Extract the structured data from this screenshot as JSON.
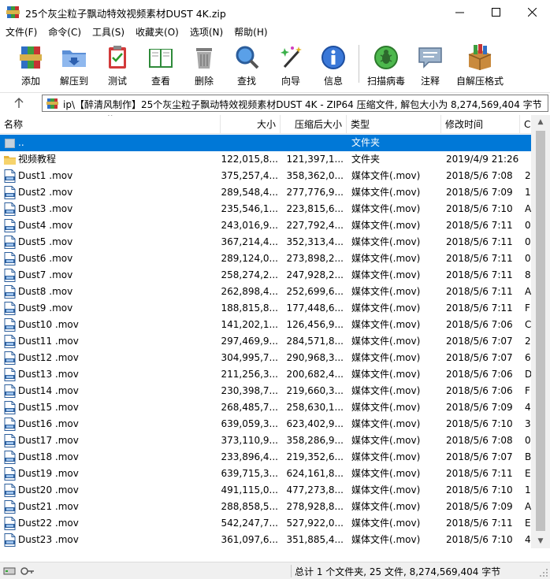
{
  "window": {
    "title": "25个灰尘粒子飘动特效视频素材DUST 4K.zip",
    "minimize_glyph": "—",
    "maximize_glyph": "☐",
    "close_glyph": "✕"
  },
  "menu": {
    "items": [
      "文件(F)",
      "命令(C)",
      "工具(S)",
      "收藏夹(O)",
      "选项(N)",
      "帮助(H)"
    ]
  },
  "toolbar": {
    "buttons": [
      {
        "label": "添加",
        "icon": "add-archive-icon"
      },
      {
        "label": "解压到",
        "icon": "extract-folder-icon"
      },
      {
        "label": "测试",
        "icon": "test-clipboard-icon"
      },
      {
        "label": "查看",
        "icon": "view-book-icon"
      },
      {
        "label": "删除",
        "icon": "trash-bin-icon"
      },
      {
        "label": "查找",
        "icon": "magnifier-icon"
      },
      {
        "label": "向导",
        "icon": "wizard-wand-icon"
      },
      {
        "label": "信息",
        "icon": "info-icon"
      },
      {
        "label": "扫描病毒",
        "icon": "virus-scan-icon"
      },
      {
        "label": "注释",
        "icon": "comment-icon"
      },
      {
        "label": "自解压格式",
        "icon": "sfx-box-icon"
      }
    ]
  },
  "address": {
    "path": "ip\\【醉清风制作】25个灰尘粒子飘动特效视频素材DUST 4K - ZIP64 压缩文件, 解包大小为 8,274,569,404 字节"
  },
  "columns": [
    "名称",
    "大小",
    "压缩后大小",
    "类型",
    "修改时间",
    "C"
  ],
  "rows": [
    {
      "name": "..",
      "size": "",
      "packed": "",
      "type": "文件夹",
      "date": "",
      "crc": "",
      "kind": "parent",
      "selected": true
    },
    {
      "name": "视频教程",
      "size": "122,015,8...",
      "packed": "121,397,1...",
      "type": "文件夹",
      "date": "2019/4/9 21:26",
      "crc": "",
      "kind": "folder"
    },
    {
      "name": "Dust1 .mov",
      "size": "375,257,4...",
      "packed": "358,362,0...",
      "type": "媒体文件(.mov)",
      "date": "2018/5/6 7:08",
      "crc": "2",
      "kind": "file"
    },
    {
      "name": "Dust2 .mov",
      "size": "289,548,4...",
      "packed": "277,776,9...",
      "type": "媒体文件(.mov)",
      "date": "2018/5/6 7:09",
      "crc": "1",
      "kind": "file"
    },
    {
      "name": "Dust3 .mov",
      "size": "235,546,1...",
      "packed": "223,815,6...",
      "type": "媒体文件(.mov)",
      "date": "2018/5/6 7:10",
      "crc": "A",
      "kind": "file"
    },
    {
      "name": "Dust4 .mov",
      "size": "243,016,9...",
      "packed": "227,792,4...",
      "type": "媒体文件(.mov)",
      "date": "2018/5/6 7:11",
      "crc": "0",
      "kind": "file"
    },
    {
      "name": "Dust5 .mov",
      "size": "367,214,4...",
      "packed": "352,313,4...",
      "type": "媒体文件(.mov)",
      "date": "2018/5/6 7:11",
      "crc": "0",
      "kind": "file"
    },
    {
      "name": "Dust6 .mov",
      "size": "289,124,0...",
      "packed": "273,898,2...",
      "type": "媒体文件(.mov)",
      "date": "2018/5/6 7:11",
      "crc": "0",
      "kind": "file"
    },
    {
      "name": "Dust7 .mov",
      "size": "258,274,2...",
      "packed": "247,928,2...",
      "type": "媒体文件(.mov)",
      "date": "2018/5/6 7:11",
      "crc": "8",
      "kind": "file"
    },
    {
      "name": "Dust8 .mov",
      "size": "262,898,4...",
      "packed": "252,699,6...",
      "type": "媒体文件(.mov)",
      "date": "2018/5/6 7:11",
      "crc": "A",
      "kind": "file"
    },
    {
      "name": "Dust9 .mov",
      "size": "188,815,8...",
      "packed": "177,448,6...",
      "type": "媒体文件(.mov)",
      "date": "2018/5/6 7:11",
      "crc": "F",
      "kind": "file"
    },
    {
      "name": "Dust10 .mov",
      "size": "141,202,1...",
      "packed": "126,456,9...",
      "type": "媒体文件(.mov)",
      "date": "2018/5/6 7:06",
      "crc": "C",
      "kind": "file"
    },
    {
      "name": "Dust11 .mov",
      "size": "297,469,9...",
      "packed": "284,571,8...",
      "type": "媒体文件(.mov)",
      "date": "2018/5/6 7:07",
      "crc": "2",
      "kind": "file"
    },
    {
      "name": "Dust12 .mov",
      "size": "304,995,7...",
      "packed": "290,968,3...",
      "type": "媒体文件(.mov)",
      "date": "2018/5/6 7:07",
      "crc": "6",
      "kind": "file"
    },
    {
      "name": "Dust13 .mov",
      "size": "211,256,3...",
      "packed": "200,682,4...",
      "type": "媒体文件(.mov)",
      "date": "2018/5/6 7:06",
      "crc": "D",
      "kind": "file"
    },
    {
      "name": "Dust14 .mov",
      "size": "230,398,7...",
      "packed": "219,660,3...",
      "type": "媒体文件(.mov)",
      "date": "2018/5/6 7:06",
      "crc": "F",
      "kind": "file"
    },
    {
      "name": "Dust15 .mov",
      "size": "268,485,7...",
      "packed": "258,630,1...",
      "type": "媒体文件(.mov)",
      "date": "2018/5/6 7:09",
      "crc": "4",
      "kind": "file"
    },
    {
      "name": "Dust16 .mov",
      "size": "639,059,3...",
      "packed": "623,402,9...",
      "type": "媒体文件(.mov)",
      "date": "2018/5/6 7:10",
      "crc": "3",
      "kind": "file"
    },
    {
      "name": "Dust17 .mov",
      "size": "373,110,9...",
      "packed": "358,286,9...",
      "type": "媒体文件(.mov)",
      "date": "2018/5/6 7:08",
      "crc": "0",
      "kind": "file"
    },
    {
      "name": "Dust18 .mov",
      "size": "233,896,4...",
      "packed": "219,352,6...",
      "type": "媒体文件(.mov)",
      "date": "2018/5/6 7:07",
      "crc": "B",
      "kind": "file"
    },
    {
      "name": "Dust19 .mov",
      "size": "639,715,3...",
      "packed": "624,161,8...",
      "type": "媒体文件(.mov)",
      "date": "2018/5/6 7:11",
      "crc": "E",
      "kind": "file"
    },
    {
      "name": "Dust20 .mov",
      "size": "491,115,0...",
      "packed": "477,273,8...",
      "type": "媒体文件(.mov)",
      "date": "2018/5/6 7:10",
      "crc": "1",
      "kind": "file"
    },
    {
      "name": "Dust21 .mov",
      "size": "288,858,5...",
      "packed": "278,928,8...",
      "type": "媒体文件(.mov)",
      "date": "2018/5/6 7:09",
      "crc": "A",
      "kind": "file"
    },
    {
      "name": "Dust22 .mov",
      "size": "542,247,7...",
      "packed": "527,922,0...",
      "type": "媒体文件(.mov)",
      "date": "2018/5/6 7:11",
      "crc": "E",
      "kind": "file"
    },
    {
      "name": "Dust23 .mov",
      "size": "361,097,6...",
      "packed": "351,885,4...",
      "type": "媒体文件(.mov)",
      "date": "2018/5/6 7:10",
      "crc": "4",
      "kind": "file"
    }
  ],
  "status": {
    "text": "总计 1 个文件夹, 25 文件, 8,274,569,404 字节"
  },
  "colors": {
    "selection": "#0078d7",
    "folder": "#f3c550",
    "file_icon": "#2b5d9b"
  }
}
